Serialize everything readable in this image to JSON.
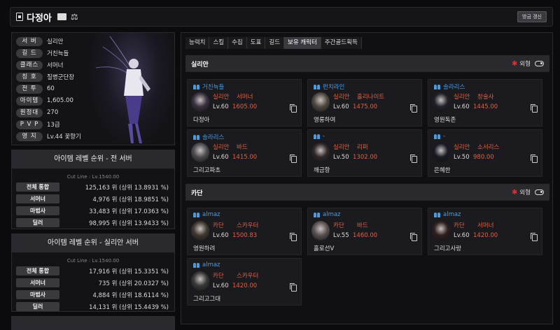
{
  "header": {
    "name": "다정아",
    "refresh_label": "방금 갱신"
  },
  "profile": {
    "stats": [
      {
        "label": "서 버",
        "value": "실리안"
      },
      {
        "label": "길 드",
        "value": "거친늑들"
      },
      {
        "label": "클래스",
        "value": "서머너"
      },
      {
        "label": "칭 호",
        "value": "질병군단장"
      },
      {
        "label": "전 투",
        "value": "60"
      },
      {
        "label": "아이템",
        "value": "1,605.00"
      },
      {
        "label": "원정대",
        "value": "270"
      },
      {
        "label": "P V P",
        "value": "13급"
      },
      {
        "label": "영 지",
        "value": "Lv.44 꽃향기"
      }
    ]
  },
  "rank_all": {
    "title": "아이템 레벨 순위 - 전 서버",
    "cutline": "Cut Line : Lv.1540.00",
    "rows": [
      {
        "label": "전체 통합",
        "value": "125,163 위 (상위 13.8931 %)"
      },
      {
        "label": "서머너",
        "value": "4,976 위 (상위 18.9851 %)"
      },
      {
        "label": "마법사",
        "value": "33,483 위 (상위 17.0363 %)"
      },
      {
        "label": "딜러",
        "value": "98,995 위 (상위 13.9433 %)"
      }
    ]
  },
  "rank_server": {
    "title": "아이템 레벨 순위 - 실리안 서버",
    "cutline": "Cut Line : Lv.1540.00",
    "rows": [
      {
        "label": "전체 통합",
        "value": "17,916 위 (상위 15.3351 %)"
      },
      {
        "label": "서머너",
        "value": "735 위 (상위 20.0327 %)"
      },
      {
        "label": "마법사",
        "value": "4,884 위 (상위 18.6114 %)"
      },
      {
        "label": "딜러",
        "value": "14,131 위 (상위 15.4439 %)"
      }
    ]
  },
  "tabs": [
    "능력치",
    "스킬",
    "수집",
    "도표",
    "길드",
    "보유 캐릭터",
    "주간골드획득"
  ],
  "active_tab": "보유 캐릭터",
  "server_groups": [
    {
      "server": "실리안",
      "toggle_label": "외형",
      "characters": [
        {
          "guild": "거친늑들",
          "server": "실리안",
          "class": "서머너",
          "level": "Lv.60",
          "item_level": "1605.00",
          "name": "다정아"
        },
        {
          "guild": "펀치라인",
          "server": "실리안",
          "class": "홀리나이트",
          "level": "Lv.60",
          "item_level": "1475.00",
          "name": "영롱하여"
        },
        {
          "guild": "솔라리스",
          "server": "실리안",
          "class": "창술사",
          "level": "Lv.60",
          "item_level": "1445.00",
          "name": "영원독존"
        },
        {
          "guild": "솔라리스",
          "server": "실리안",
          "class": "바드",
          "level": "Lv.60",
          "item_level": "1415.00",
          "name": "그리고파초"
        },
        {
          "guild": "-",
          "server": "실리안",
          "class": "리퍼",
          "level": "Lv.50",
          "item_level": "1302.00",
          "name": "깨금항"
        },
        {
          "guild": "-",
          "server": "실리안",
          "class": "소서리스",
          "level": "Lv.50",
          "item_level": "980.00",
          "name": "은혜한"
        }
      ]
    },
    {
      "server": "카단",
      "toggle_label": "외형",
      "characters": [
        {
          "guild": "almaz",
          "server": "카단",
          "class": "스카우터",
          "level": "Lv.60",
          "item_level": "1500.83",
          "name": "영원하려"
        },
        {
          "guild": "almaz",
          "server": "카단",
          "class": "바드",
          "level": "Lv.55",
          "item_level": "1460.00",
          "name": "홀로선V"
        },
        {
          "guild": "almaz",
          "server": "카단",
          "class": "서머너",
          "level": "Lv.60",
          "item_level": "1420.00",
          "name": "그리고사랑"
        },
        {
          "guild": "almaz",
          "server": "카단",
          "class": "스카우터",
          "level": "Lv.60",
          "item_level": "1420.00",
          "name": "그리고그대"
        }
      ]
    }
  ],
  "colors": {
    "accent": "#e06040",
    "guild": "#4a9ae0",
    "star": "#e03030"
  }
}
